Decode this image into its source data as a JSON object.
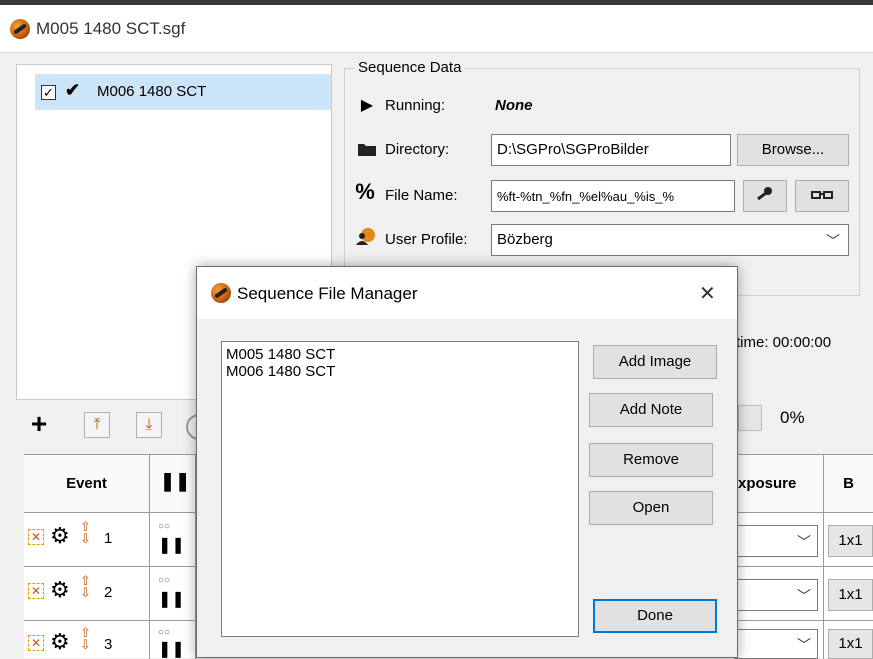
{
  "window": {
    "title": "M005 1480 SCT.sgf"
  },
  "sequence_list": {
    "items": [
      {
        "label": "M006 1480 SCT",
        "checked": true
      }
    ]
  },
  "sequence_data": {
    "group_label": "Sequence Data",
    "running_label": "Running:",
    "running_value": "None",
    "directory_label": "Directory:",
    "directory_value": "D:\\SGPro\\SGProBilder",
    "browse_label": "Browse...",
    "filename_label": "File Name:",
    "filename_value": "%ft-%tn_%fn_%el%au_%is_%",
    "profile_label": "User Profile:",
    "profile_value": "Bözberg"
  },
  "status": {
    "time_text": "time: 00:00:00",
    "progress_text": "0%",
    "progress": 0
  },
  "grid": {
    "headers": {
      "event": "Event",
      "exposure": "xposure",
      "binning": "B"
    },
    "rows": [
      {
        "num": "1",
        "bin": "1x1"
      },
      {
        "num": "2",
        "bin": "1x1"
      },
      {
        "num": "3",
        "bin": "1x1"
      }
    ]
  },
  "dialog": {
    "title": "Sequence File Manager",
    "close_glyph": "✕",
    "files": [
      "M005 1480 SCT",
      "M006 1480 SCT"
    ],
    "buttons": {
      "add_image": "Add Image",
      "add_note": "Add Note",
      "remove": "Remove",
      "open": "Open",
      "done": "Done"
    }
  },
  "icons": [
    "app-icon",
    "check-icon",
    "play-icon",
    "folder-icon",
    "percent-icon",
    "profile-icon",
    "key-icon",
    "glasses-icon",
    "add-icon",
    "move-top-icon",
    "move-bottom-icon",
    "pause-icon",
    "gear-icon",
    "reorder-icon",
    "disable-icon",
    "close-icon",
    "chevron-down-icon"
  ]
}
